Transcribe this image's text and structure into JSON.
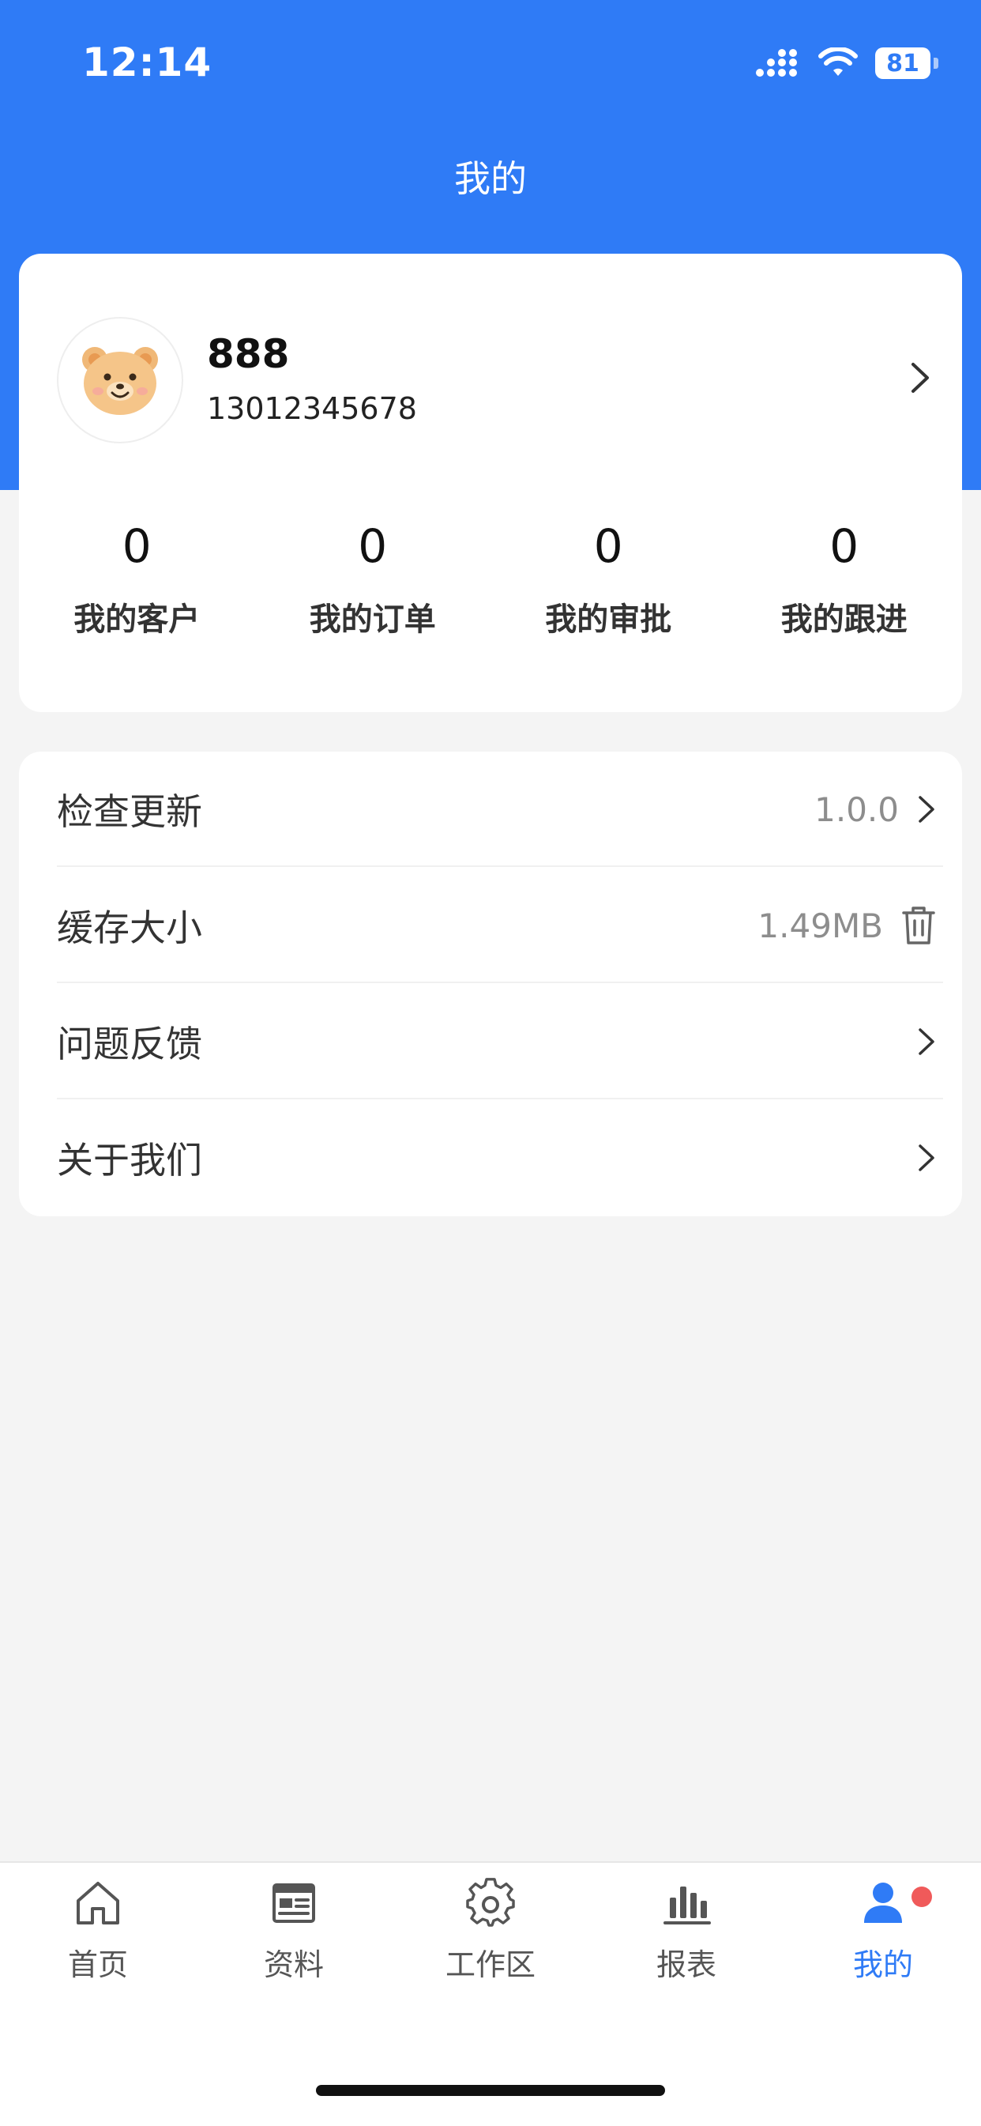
{
  "status_bar": {
    "time": "12:14",
    "battery": "81"
  },
  "header": {
    "title": "我的"
  },
  "profile": {
    "name": "888",
    "phone": "13012345678",
    "stats": [
      {
        "value": "0",
        "label": "我的客户"
      },
      {
        "value": "0",
        "label": "我的订单"
      },
      {
        "value": "0",
        "label": "我的审批"
      },
      {
        "value": "0",
        "label": "我的跟进"
      }
    ]
  },
  "settings": [
    {
      "label": "检查更新",
      "value": "1.0.0",
      "icon": "chevron-right-icon"
    },
    {
      "label": "缓存大小",
      "value": "1.49MB",
      "icon": "trash-icon"
    },
    {
      "label": "问题反馈",
      "value": "",
      "icon": "chevron-right-icon"
    },
    {
      "label": "关于我们",
      "value": "",
      "icon": "chevron-right-icon"
    }
  ],
  "tabbar": {
    "items": [
      {
        "label": "首页",
        "icon": "home-icon"
      },
      {
        "label": "资料",
        "icon": "document-icon"
      },
      {
        "label": "工作区",
        "icon": "gear-icon"
      },
      {
        "label": "报表",
        "icon": "bar-chart-icon"
      },
      {
        "label": "我的",
        "icon": "user-icon"
      }
    ],
    "active": "我的"
  },
  "colors": {
    "accent": "#2f7bf6",
    "badge": "#f05a5a",
    "background": "#f4f4f4"
  }
}
